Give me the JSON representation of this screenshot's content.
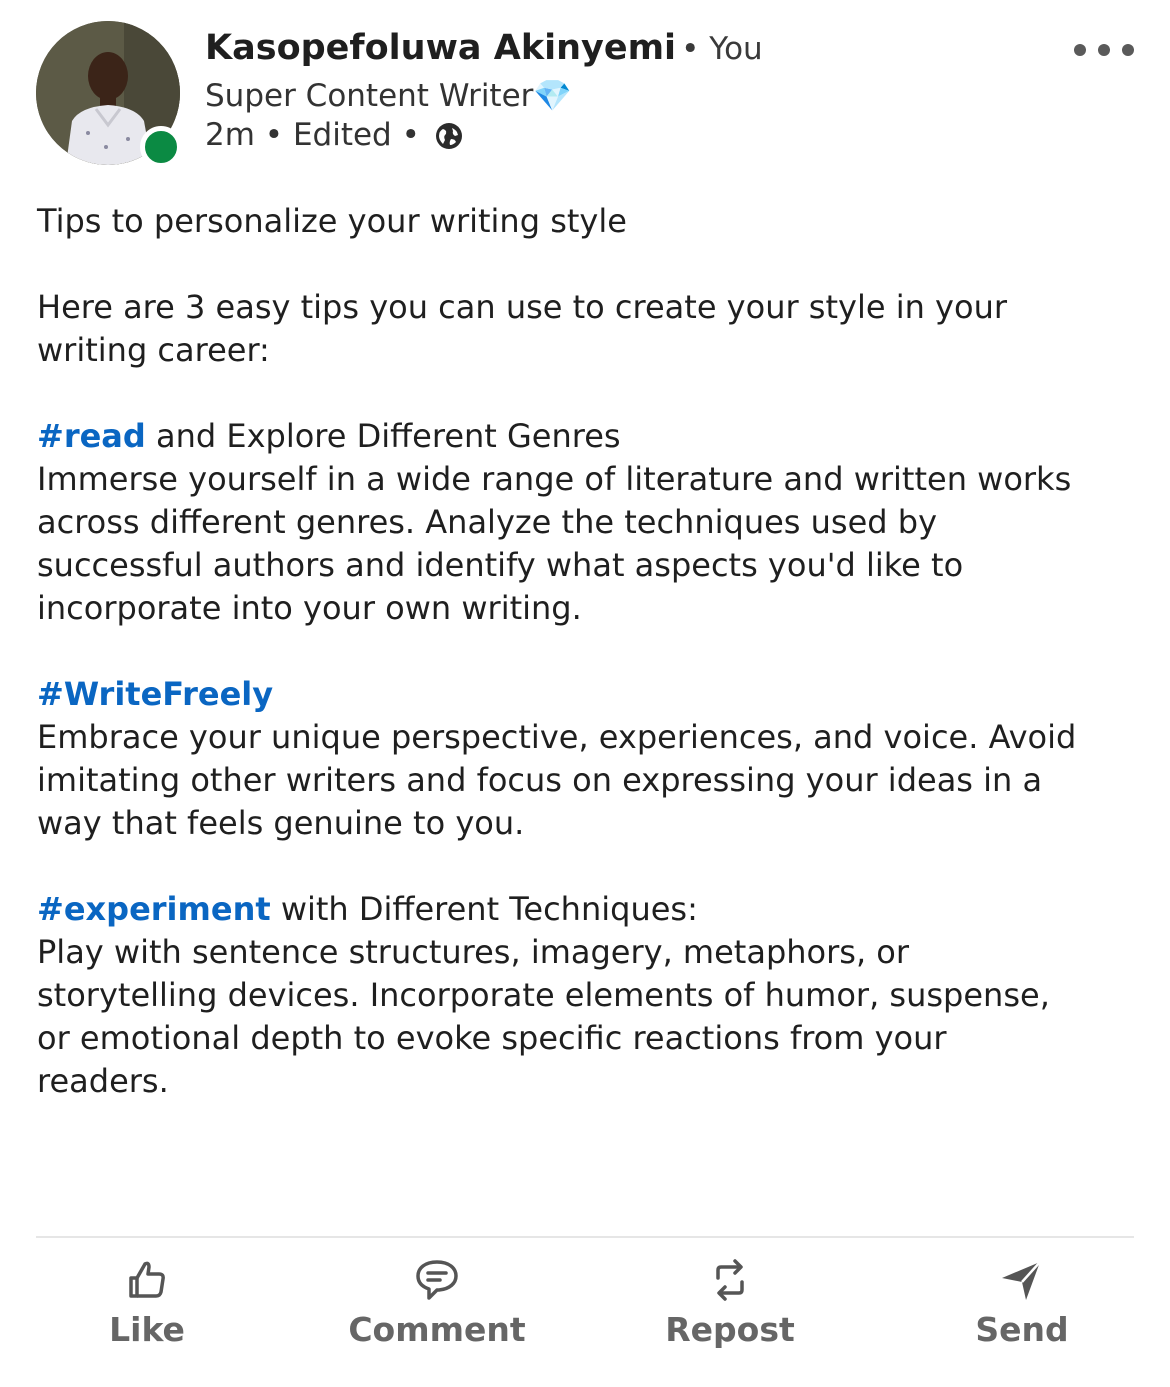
{
  "author": {
    "name": "Kasopefoluwa Akinyemi",
    "degree": "• You",
    "headline": "Super Content Writer",
    "headline_emoji": "💎",
    "time": "2m",
    "sep1": "•",
    "edited": "Edited",
    "sep2": "•",
    "visibility_icon": "globe-icon",
    "presence_color": "#0b8a43"
  },
  "post": {
    "title": "Tips to personalize your writing style",
    "intro_1": "Here are 3 easy tips you can use to create your style in your",
    "intro_2": "writing career:",
    "tip1": {
      "tag": "#read",
      "heading_rest": " and Explore Different Genres",
      "lines": [
        "Immerse yourself in a wide range of literature and written works",
        "across different genres. Analyze the techniques used by",
        "successful authors and identify what aspects you'd like to",
        "incorporate into your own writing."
      ]
    },
    "tip2": {
      "tag": "#WriteFreely",
      "lines": [
        "Embrace your unique perspective, experiences, and voice. Avoid",
        "imitating other writers and focus on expressing your ideas in a",
        "way that feels genuine to you."
      ]
    },
    "tip3": {
      "tag": "#experiment",
      "heading_rest": " with Different Techniques:",
      "lines": [
        "Play with sentence structures, imagery, metaphors, or",
        "storytelling devices. Incorporate elements of humor, suspense,",
        "or emotional depth to evoke specific reactions from your",
        "readers."
      ]
    },
    "hashtag_color": "#0a66c2"
  },
  "actions": {
    "like": {
      "label": "Like",
      "icon": "thumbs-up-icon"
    },
    "comment": {
      "label": "Comment",
      "icon": "comment-icon"
    },
    "repost": {
      "label": "Repost",
      "icon": "repost-icon"
    },
    "send": {
      "label": "Send",
      "icon": "send-icon"
    }
  }
}
